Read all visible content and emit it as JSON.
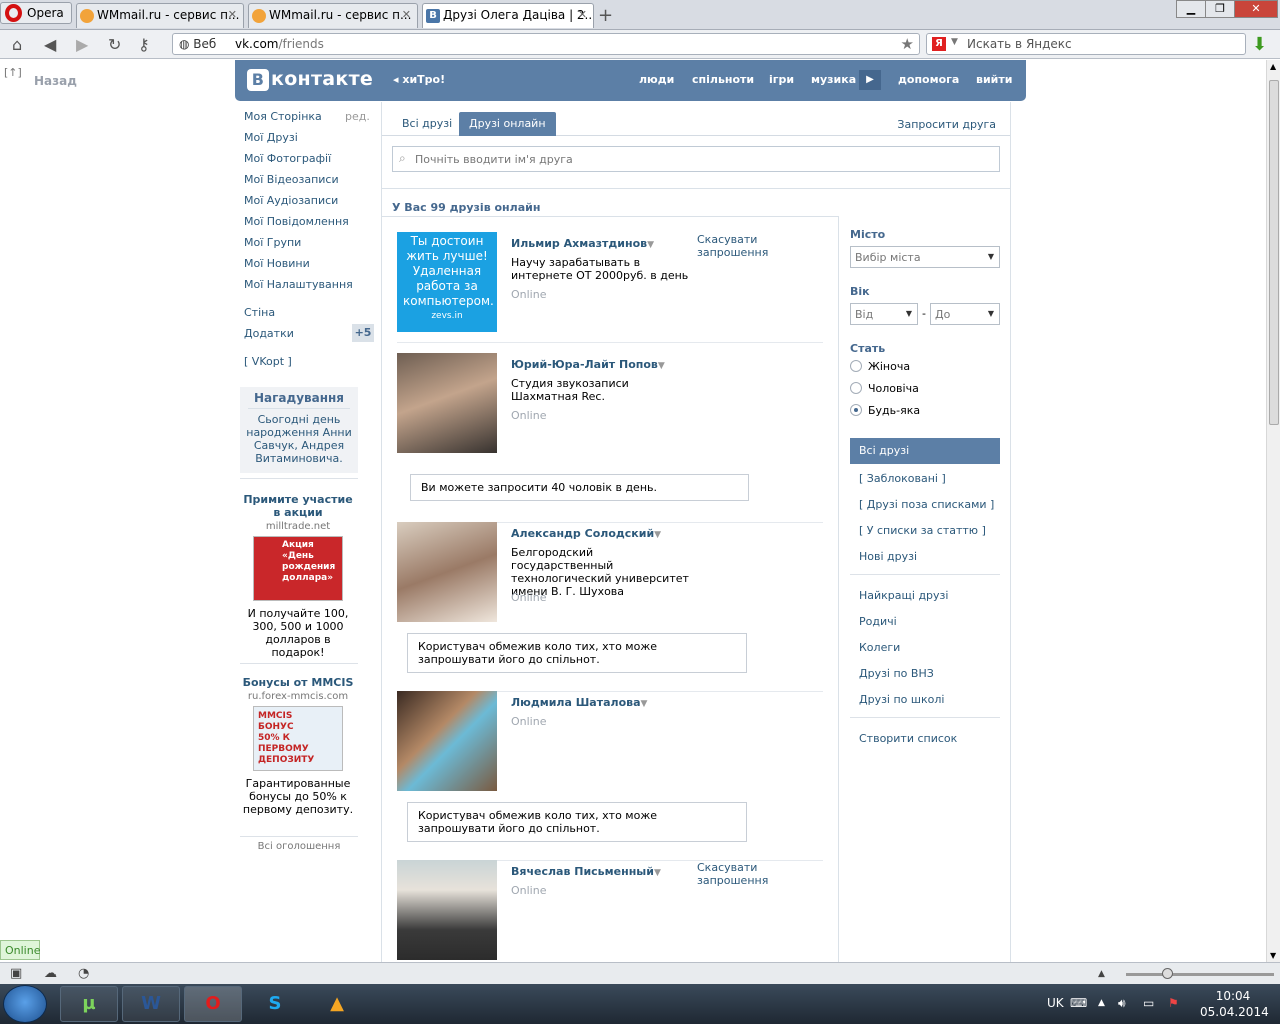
{
  "browser": {
    "menu_label": "Opera",
    "tabs": [
      {
        "title": "WMmail.ru - сервис п..."
      },
      {
        "title": "WMmail.ru - сервис п..."
      },
      {
        "title": "Друзі Олега Даціва | 2..."
      }
    ],
    "address_prefix": "Веб",
    "url_host": "vk.com",
    "url_path": "/friends",
    "search_placeholder": "Искать в Яндекс",
    "back_label": "Назад",
    "status_online": "Online"
  },
  "vk": {
    "logo": "контакте",
    "logo_letter": "В",
    "status": "хиТро!",
    "nav": [
      "люди",
      "спільноти",
      "ігри",
      "музика",
      "допомога",
      "вийти"
    ],
    "left_menu": [
      "Моя Сторінка",
      "Мої Друзі",
      "Мої Фотографії",
      "Мої Відеозаписи",
      "Мої Аудіозаписи",
      "Мої Повідомлення",
      "Мої Групи",
      "Мої Новини",
      "Мої Налаштування"
    ],
    "edit_label": "ред.",
    "wall": "Стіна",
    "apps": "Додатки",
    "apps_count": "+5",
    "vkopt": "[ VKopt ]",
    "reminder": {
      "title": "Нагадування",
      "text": "Сьогодні день народження Анни Савчук, Андрея Витаминовича."
    },
    "ads": [
      {
        "title": "Примите участие в акции",
        "domain": "milltrade.net",
        "img_text": "Акция «День рождения доллара»",
        "text": "И получайте 100, 300, 500 и 1000 долларов в подарок!"
      },
      {
        "title": "Бонусы от MMCIS",
        "domain": "ru.forex-mmcis.com",
        "img_text": "MMCIS БОНУС 50% К ПЕРВОМУ ДЕПОЗИТУ",
        "text": "Гарантированные бонусы до 50% к первому депозиту."
      }
    ],
    "all_ads": "Всі оголошення"
  },
  "friends": {
    "tab_all": "Всі друзі",
    "tab_online": "Друзі онлайн",
    "invite": "Запросити друга",
    "search_placeholder": "Почніть вводити ім'я друга",
    "count_text": "У Вас 99 друзів онлайн",
    "cancel_label": "Скасувати запрошення",
    "online_label": "Online",
    "list": [
      {
        "name": "Ильмир Ахмазтдинов",
        "info": "Научу зарабатывать в интернете ОТ 2000руб. в день",
        "photo_text": "Ты достоин жить лучше! Удаленная работа за компьютером.",
        "photo_brand": "zevs.in"
      },
      {
        "name": "Юрий-Юра-Лайт Попов",
        "info": "Студия звукозаписи Шахматная Rec.",
        "note": "Ви можете запросити 40 чоловік в день."
      },
      {
        "name": "Александр Солодский",
        "info": "Белгородский государственный технологический университет имени В. Г. Шухова",
        "note": "Користувач обмежив коло тих, хто може запрошувати його до спільнот."
      },
      {
        "name": "Людмила Шаталова",
        "info": "",
        "note": "Користувач обмежив коло тих, хто може запрошувати його до спільнот."
      },
      {
        "name": "Вячеслав Письменный",
        "info": ""
      }
    ]
  },
  "filters": {
    "city_label": "Місто",
    "city_value": "Вибір міста",
    "age_label": "Вік",
    "age_from": "Від",
    "age_to": "До",
    "age_dash": "-",
    "sex_label": "Стать",
    "sex_options": [
      "Жіноча",
      "Чоловіча",
      "Будь-яка"
    ],
    "lists_selected": "Всі друзі",
    "lists": [
      "[ Заблоковані ]",
      "[ Друзі поза списками ]",
      "[ У списки за статтю ]",
      "Нові друзі"
    ],
    "groups": [
      "Найкращі друзі",
      "Родичі",
      "Колеги",
      "Друзі по ВНЗ",
      "Друзі по школі"
    ],
    "create_list": "Створити список"
  },
  "taskbar": {
    "lang": "UK",
    "time": "10:04",
    "date": "05.04.2014"
  },
  "colors": {
    "vk_blue": "#5c7fa6",
    "link": "#2b587a"
  }
}
